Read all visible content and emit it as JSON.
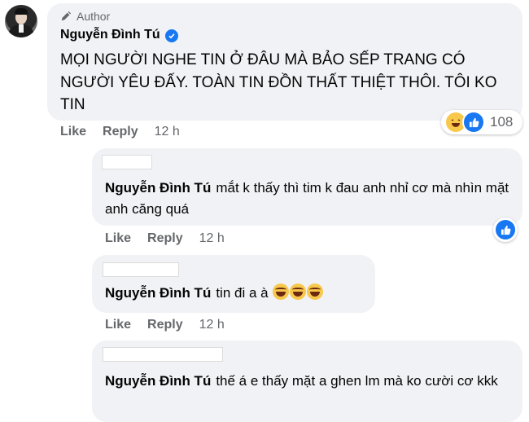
{
  "post": {
    "author_badge": "Author",
    "author_name": "Nguyễn Đình Tú",
    "text": "MỌI NGƯỜI NGHE TIN Ở ĐÂU MÀ BẢO SẾP TRANG CÓ NGƯỜI YÊU ĐẤY. TOÀN TIN ĐỒN THẤT THIỆT THÔI. TÔI KO TIN",
    "actions": {
      "like": "Like",
      "reply": "Reply",
      "time": "12 h"
    },
    "reactions": {
      "icons": [
        "haha-icon",
        "like-icon"
      ],
      "count": "108"
    }
  },
  "replies": [
    {
      "name": "Nguyễn Đình Tú",
      "text": "mắt k thấy thì tim k đau anh nhỉ cơ mà nhìn mặt anh căng quá",
      "actions": {
        "like": "Like",
        "reply": "Reply",
        "time": "12 h"
      },
      "reaction_icon": "like-icon"
    },
    {
      "name": "Nguyễn Đình Tú",
      "text": "tin đi a à",
      "emoji": [
        "laughing-face",
        "laughing-face",
        "laughing-face"
      ],
      "actions": {
        "like": "Like",
        "reply": "Reply",
        "time": "12 h"
      }
    },
    {
      "name": "Nguyễn Đình Tú",
      "text": "thế á e thấy mặt a ghen lm mà ko cười cơ kkk"
    }
  ],
  "colors": {
    "bubble_bg": "#f0f2f5",
    "meta_gray": "#65676b",
    "brand_blue": "#1877f2",
    "haha_yellow": "#f7c84c"
  }
}
